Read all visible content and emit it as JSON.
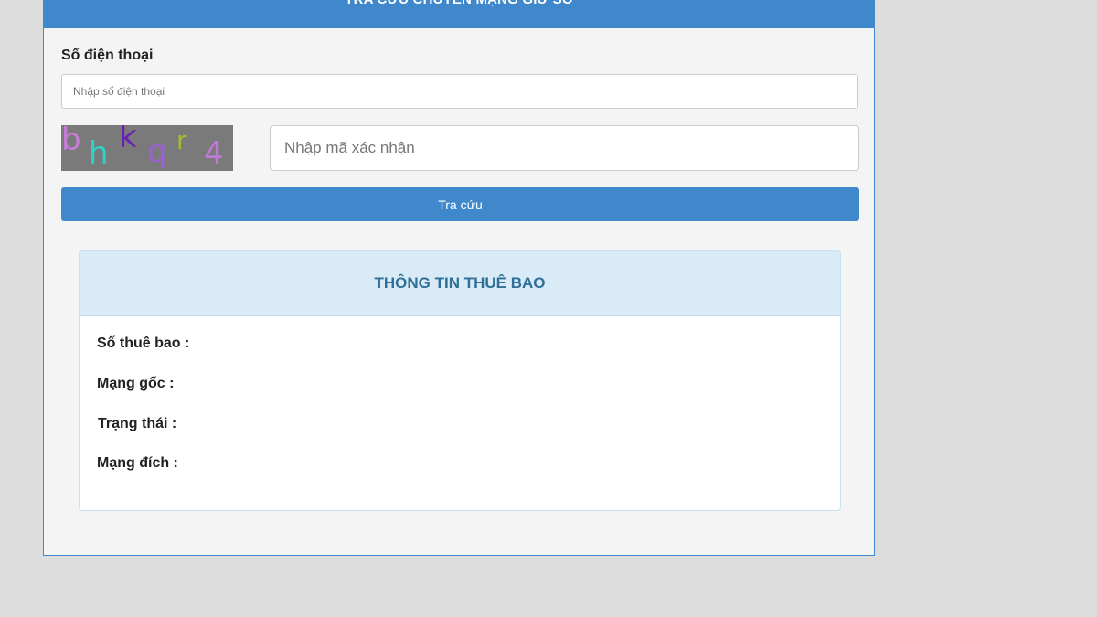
{
  "header": {
    "title": "TRA CỨU CHUYỂN MẠNG GIỮ SỐ"
  },
  "phone": {
    "label": "Số điện thoại",
    "placeholder": "Nhập số điện thoại",
    "value": ""
  },
  "captcha": {
    "chars": [
      "b",
      "h",
      "k",
      "q",
      "r",
      "4"
    ],
    "char_colors": [
      "#c77cd8",
      "#2fd1c9",
      "#6a1fb3",
      "#9a62d0",
      "#a8b832",
      "#c079d6"
    ],
    "placeholder": "Nhập mã xác nhận",
    "value": ""
  },
  "lookup_button": {
    "label": "Tra cứu"
  },
  "subscriber_info": {
    "title": "THÔNG TIN THUÊ BAO",
    "rows": [
      {
        "label": "Số thuê bao :",
        "value": ""
      },
      {
        "label": "Mạng gốc :",
        "value": ""
      },
      {
        "label": "Trạng thái :",
        "value": ""
      },
      {
        "label": "Mạng đích :",
        "value": ""
      }
    ]
  },
  "colors": {
    "primary": "#3f88cb",
    "panel_background": "#f4f4f4",
    "info_header_background": "#d9ebf6",
    "info_header_text": "#2f6f98"
  }
}
